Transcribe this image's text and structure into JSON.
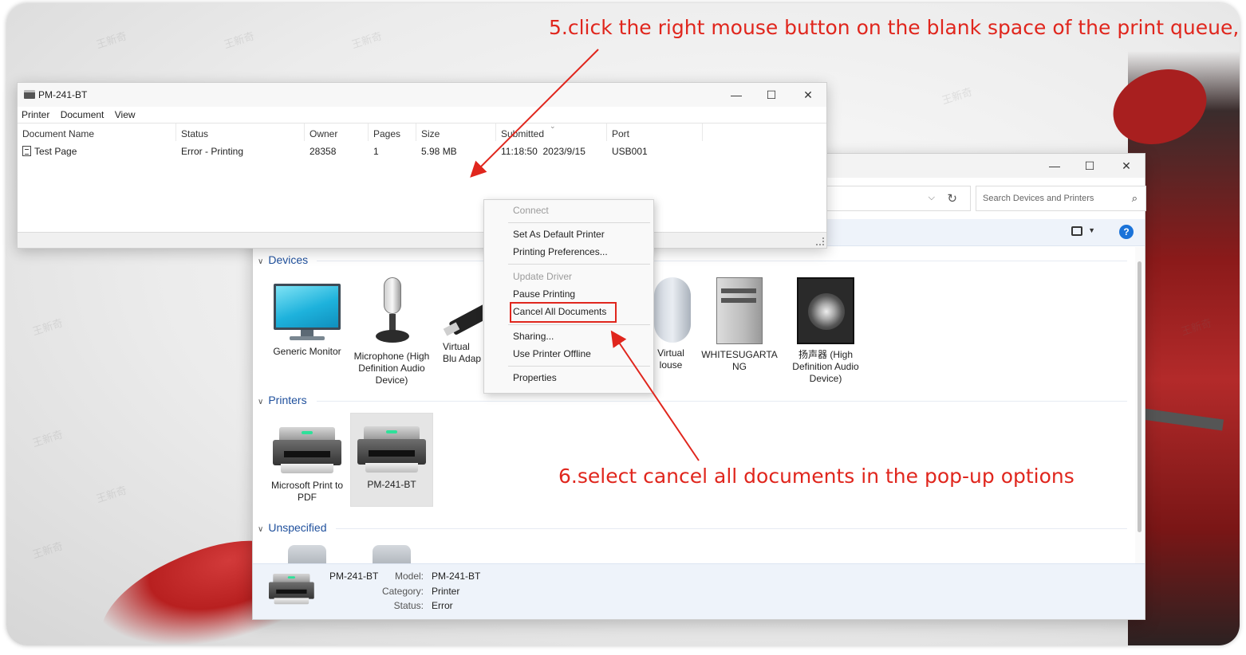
{
  "instructions": {
    "step5": "5.click the right mouse button on the blank space of the print queue,",
    "step6": "6.select cancel all documents in the pop-up options"
  },
  "colors": {
    "annotation": "#e0261d",
    "accent": "#1a73d9",
    "group_heading": "#1e4f9c"
  },
  "print_queue": {
    "title": "PM-241-BT",
    "menu": [
      "Printer",
      "Document",
      "View"
    ],
    "columns": [
      "Document Name",
      "Status",
      "Owner",
      "Pages",
      "Size",
      "Submitted",
      "Port"
    ],
    "rows": [
      {
        "document_name": "Test Page",
        "status": "Error - Printing",
        "owner": "28358",
        "pages": "1",
        "size": "5.98 MB",
        "submitted": "11:18:50  2023/9/15",
        "port": "USB001"
      }
    ],
    "controls": {
      "minimize": "—",
      "maximize": "☐",
      "close": "✕"
    }
  },
  "context_menu": {
    "items": [
      {
        "label": "Connect",
        "enabled": false
      },
      {
        "label": "Set As Default Printer",
        "enabled": true
      },
      {
        "label": "Printing Preferences...",
        "enabled": true
      },
      {
        "label": "Update Driver",
        "enabled": false
      },
      {
        "label": "Pause Printing",
        "enabled": true
      },
      {
        "label": "Cancel All Documents",
        "enabled": true,
        "highlighted": true
      },
      {
        "label": "Sharing...",
        "enabled": true
      },
      {
        "label": "Use Printer Offline",
        "enabled": true
      },
      {
        "label": "Properties",
        "enabled": true
      }
    ]
  },
  "devices_window": {
    "search_placeholder": "Search Devices and Printers",
    "controls": {
      "minimize": "—",
      "maximize": "☐",
      "close": "✕"
    },
    "groups": {
      "devices": {
        "heading": "Devices",
        "items": [
          {
            "label": "Generic Monitor",
            "icon": "monitor-icon"
          },
          {
            "label": "Microphone (High Definition Audio Device)",
            "icon": "microphone-icon"
          },
          {
            "label": "Virtual Blu Adap",
            "icon": "usb-adapter-icon"
          },
          {
            "label": "Virtual louse",
            "icon": "mouse-icon"
          },
          {
            "label": "WHITESUGARTA NG",
            "icon": "computer-tower-icon"
          },
          {
            "label": "扬声器 (High Definition Audio Device)",
            "icon": "speaker-icon"
          }
        ]
      },
      "printers": {
        "heading": "Printers",
        "items": [
          {
            "label": "Microsoft Print to PDF",
            "icon": "printer-icon"
          },
          {
            "label": "PM-241-BT",
            "icon": "printer-icon",
            "selected": true
          }
        ]
      },
      "unspecified": {
        "heading": "Unspecified"
      }
    },
    "details": {
      "name": "PM-241-BT",
      "model_key": "Model:",
      "model": "PM-241-BT",
      "category_key": "Category:",
      "category": "Printer",
      "status_key": "Status:",
      "status": "Error"
    }
  },
  "watermark": "王新奇"
}
